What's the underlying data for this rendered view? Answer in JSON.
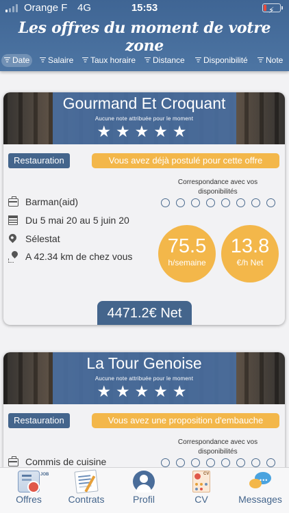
{
  "status_bar": {
    "carrier": "Orange F",
    "network": "4G",
    "time": "15:53"
  },
  "header": {
    "title": "Les offres du moment de votre zone"
  },
  "filters": [
    {
      "label": "Date",
      "active": true
    },
    {
      "label": "Salaire",
      "active": false
    },
    {
      "label": "Taux horaire",
      "active": false
    },
    {
      "label": "Distance",
      "active": false
    },
    {
      "label": "Disponibilité",
      "active": false
    },
    {
      "label": "Note",
      "active": false
    }
  ],
  "offers": [
    {
      "name": "Gourmand Et Croquant",
      "rating_note": "Aucune note attribuée pour le moment",
      "stars": "★★★★★",
      "category": "Restauration",
      "status": "Vous avez déjà postulé pour cette offre",
      "match_title": "Correspondance avec vos disponibilités",
      "job": "Barman(aid)",
      "dates": "Du 5 mai 20 au 5 juin 20",
      "city": "Sélestat",
      "distance": "A 42.34 km de chez vous",
      "hours_value": "75.5",
      "hours_unit": "h/semaine",
      "rate_value": "13.8",
      "rate_unit": "€/h Net",
      "salary": "4471.2€ Net"
    },
    {
      "name": "La Tour Genoise",
      "rating_note": "Aucune note attribuée pour le moment",
      "stars": "★★★★★",
      "category": "Restauration",
      "status": "Vous avez une proposition d'embauche",
      "match_title": "Correspondance avec vos disponibilités",
      "job": "Commis de cuisine"
    }
  ],
  "tabbar": {
    "items": [
      {
        "label": "Offres",
        "icon": "offers-icon",
        "badge": "JOB"
      },
      {
        "label": "Contrats",
        "icon": "contracts-icon"
      },
      {
        "label": "Profil",
        "icon": "profile-icon"
      },
      {
        "label": "CV",
        "icon": "cv-icon",
        "badge": "CV"
      },
      {
        "label": "Messages",
        "icon": "messages-icon",
        "badge": "•••"
      }
    ]
  },
  "colors": {
    "header_blue": "#4a6f9d",
    "accent_orange": "#f3b74a",
    "tag_blue": "#44658c"
  }
}
